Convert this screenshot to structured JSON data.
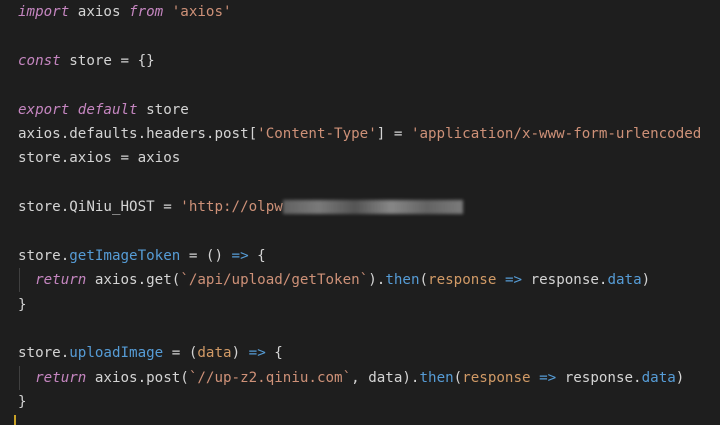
{
  "lines": [
    {
      "tokens": [
        [
          "kw",
          "import"
        ],
        [
          "plain",
          " axios "
        ],
        [
          "kw",
          "from"
        ],
        [
          "plain",
          " "
        ],
        [
          "str",
          "'axios'"
        ]
      ]
    },
    {
      "tokens": []
    },
    {
      "tokens": [
        [
          "kw",
          "const"
        ],
        [
          "plain",
          " store = {}"
        ]
      ]
    },
    {
      "tokens": []
    },
    {
      "tokens": [
        [
          "kw",
          "export"
        ],
        [
          "plain",
          " "
        ],
        [
          "kw",
          "default"
        ],
        [
          "plain",
          " store"
        ]
      ]
    },
    {
      "tokens": [
        [
          "plain",
          "axios.defaults.headers.post["
        ],
        [
          "str",
          "'Content-Type'"
        ],
        [
          "plain",
          "] = "
        ],
        [
          "str",
          "'application/x-www-form-urlencoded"
        ]
      ]
    },
    {
      "tokens": [
        [
          "plain",
          "store.axios = axios"
        ]
      ]
    },
    {
      "tokens": []
    },
    {
      "tokens": [
        [
          "plain",
          "store.QiNiu_HOST = "
        ],
        [
          "str",
          "'http://olpw"
        ]
      ]
    },
    {
      "tokens": []
    },
    {
      "tokens": [
        [
          "plain",
          "store."
        ],
        [
          "prop",
          "getImageToken"
        ],
        [
          "plain",
          " = () "
        ],
        [
          "prop",
          "=>"
        ],
        [
          "plain",
          " {"
        ]
      ]
    },
    {
      "tokens": [
        [
          "plain",
          "  "
        ],
        [
          "kw",
          "return"
        ],
        [
          "plain",
          " axios.get("
        ],
        [
          "str",
          "`/api/upload/getToken`"
        ],
        [
          "plain",
          ")."
        ],
        [
          "prop",
          "then"
        ],
        [
          "plain",
          "("
        ],
        [
          "param",
          "response"
        ],
        [
          "plain",
          " "
        ],
        [
          "prop",
          "=>"
        ],
        [
          "plain",
          " response."
        ],
        [
          "prop",
          "data"
        ],
        [
          "plain",
          ")"
        ]
      ]
    },
    {
      "tokens": [
        [
          "plain",
          "}"
        ]
      ]
    },
    {
      "tokens": []
    },
    {
      "tokens": [
        [
          "plain",
          "store."
        ],
        [
          "prop",
          "uploadImage"
        ],
        [
          "plain",
          " = ("
        ],
        [
          "param",
          "data"
        ],
        [
          "plain",
          ") "
        ],
        [
          "prop",
          "=>"
        ],
        [
          "plain",
          " {"
        ]
      ]
    },
    {
      "tokens": [
        [
          "plain",
          "  "
        ],
        [
          "kw",
          "return"
        ],
        [
          "plain",
          " axios.post("
        ],
        [
          "str",
          "`//up-z2.qiniu.com`"
        ],
        [
          "plain",
          ", data)."
        ],
        [
          "prop",
          "then"
        ],
        [
          "plain",
          "("
        ],
        [
          "param",
          "response"
        ],
        [
          "plain",
          " "
        ],
        [
          "prop",
          "=>"
        ],
        [
          "plain",
          " response."
        ],
        [
          "prop",
          "data"
        ],
        [
          "plain",
          ")"
        ]
      ]
    },
    {
      "tokens": [
        [
          "plain",
          "}"
        ]
      ]
    }
  ],
  "colors": {
    "background": "#1e1e1e",
    "keyword": "#c586c0",
    "string": "#ce9178",
    "property": "#569cd6",
    "param": "#d19a66",
    "plain": "#d4d4d4"
  },
  "icons": {
    "blurred-region": "redacted-text-blur"
  }
}
